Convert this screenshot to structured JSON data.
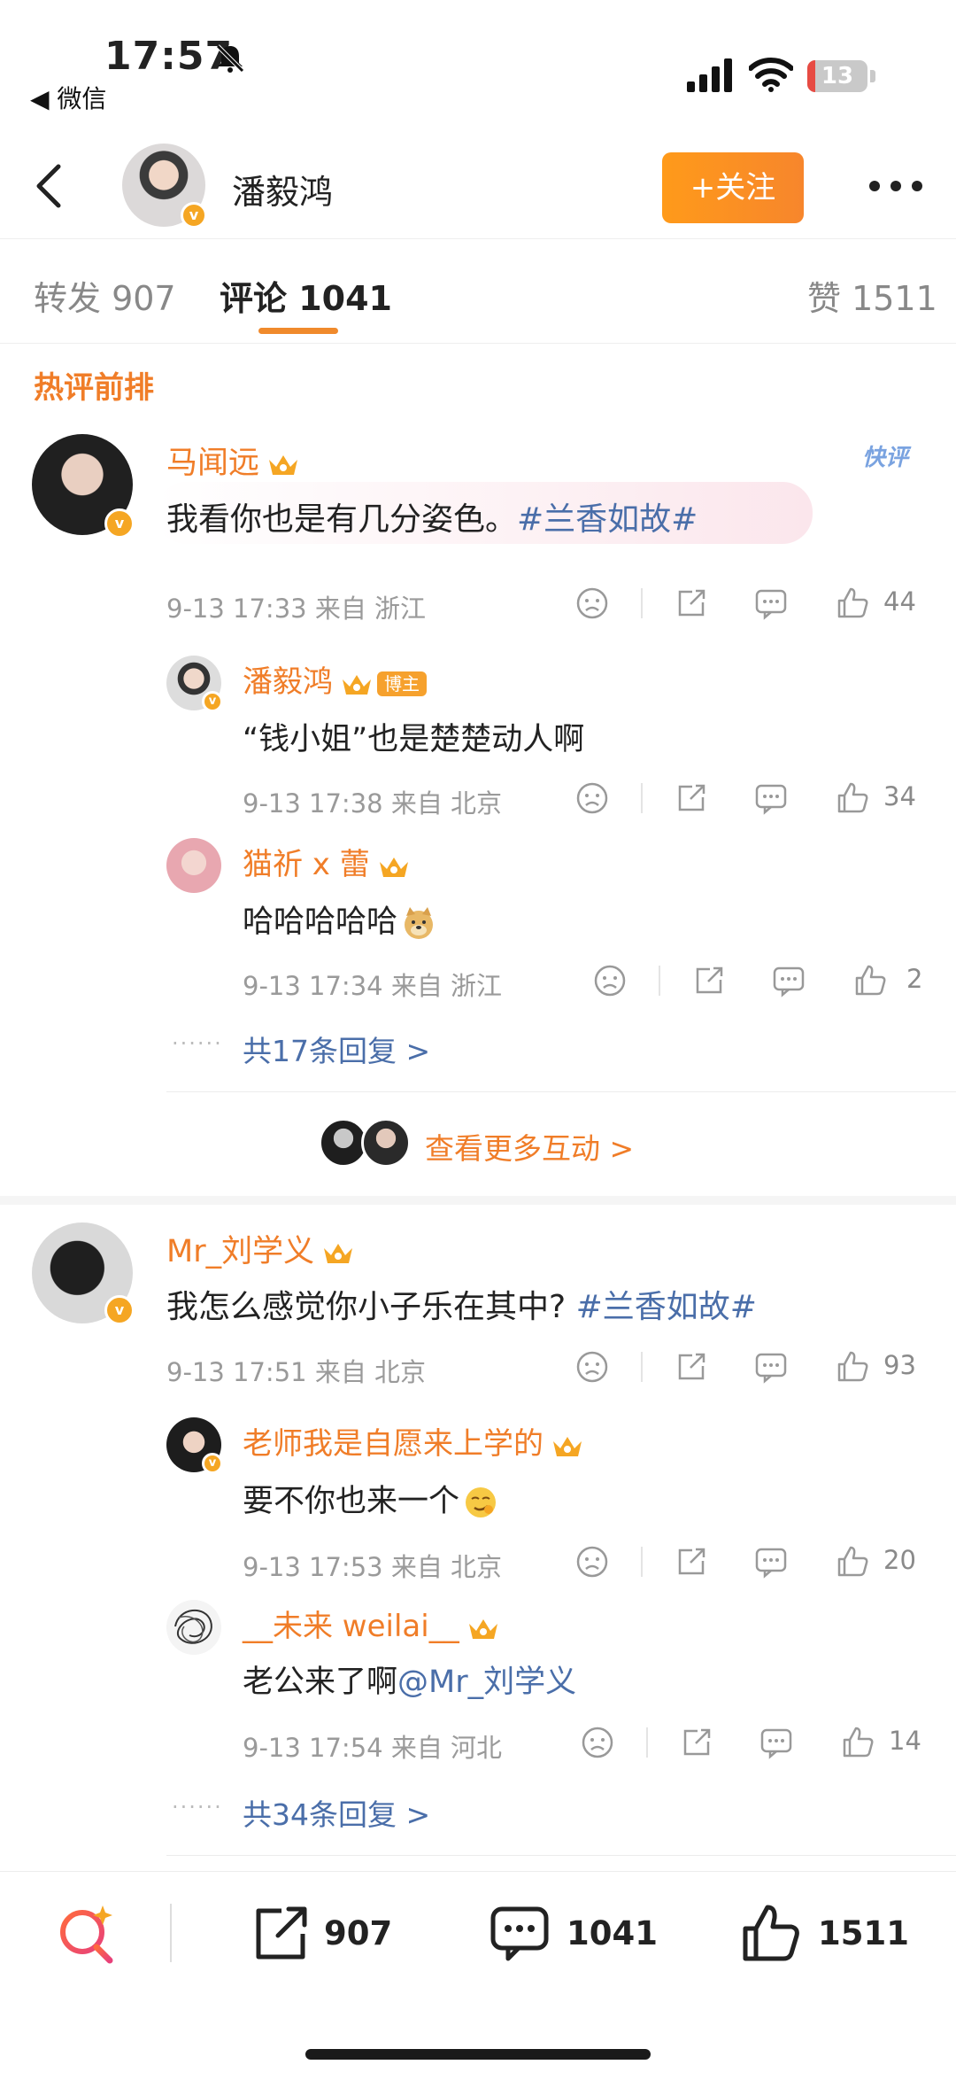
{
  "status_bar": {
    "time": "17:57",
    "back_app": "◀ 微信",
    "battery": "13"
  },
  "header": {
    "user_name": "潘毅鸿",
    "follow_label": "+关注"
  },
  "tabs": {
    "repost": "转发 907",
    "comments": "评论 1041",
    "likes": "赞 1511"
  },
  "section_title": "热评前排",
  "quick_label": "快评",
  "comments": [
    {
      "name": "马闻远",
      "text": "我看你也是有几分姿色。",
      "topic": "#兰香如故#",
      "meta": "9-13 17:33 来自 浙江",
      "likes": "44",
      "replies": [
        {
          "name": "潘毅鸿",
          "tag": "博主",
          "text": "“钱小姐”也是楚楚动人啊",
          "meta": "9-13 17:38 来自 北京",
          "likes": "34"
        },
        {
          "name": "猫祈 x 蕾",
          "text": "哈哈哈哈哈",
          "meta": "9-13 17:34 来自 浙江",
          "likes": "2"
        }
      ],
      "reply_all": "共17条回复 >"
    },
    {
      "name": "Mr_刘学义",
      "text": "我怎么感觉你小子乐在其中?",
      "topic": "#兰香如故#",
      "meta": "9-13 17:51 来自 北京",
      "likes": "93",
      "replies": [
        {
          "name": "老师我是自愿来上学的",
          "text": "要不你也来一个",
          "meta": "9-13 17:53 来自 北京",
          "likes": "20"
        },
        {
          "name": "__未来 weilai__",
          "text": "老公来了啊",
          "mention": "@Mr_刘学义",
          "meta": "9-13 17:54 来自 河北",
          "likes": "14"
        }
      ],
      "reply_all": "共34条回复 >"
    }
  ],
  "more_interactions": "查看更多互动 >",
  "bottom_bar": {
    "repost_count": "907",
    "comment_count": "1041",
    "like_count": "1511"
  },
  "colors": {
    "accent": "#f07d28",
    "link": "#4a6ea9",
    "verified": "#f5a623"
  }
}
